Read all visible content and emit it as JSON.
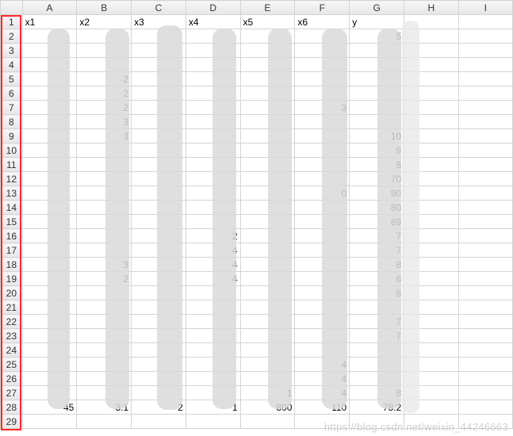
{
  "columns": [
    "A",
    "B",
    "C",
    "D",
    "E",
    "F",
    "G",
    "H",
    "I"
  ],
  "rowCount": 29,
  "headerRow": {
    "A": "x1",
    "B": "x2",
    "C": "x3",
    "D": "x4",
    "E": "x5",
    "F": "x6",
    "G": "y"
  },
  "cells": {
    "r2": {
      "G": "5"
    },
    "r5": {
      "B": "2"
    },
    "r6": {
      "B": "2"
    },
    "r7": {
      "B": "2",
      "F": "3"
    },
    "r8": {
      "B": "3"
    },
    "r9": {
      "B": "3",
      "G": "10"
    },
    "r10": {
      "G": "9"
    },
    "r11": {
      "G": "8"
    },
    "r12": {
      "G": "70"
    },
    "r13": {
      "F": "0",
      "G": "90"
    },
    "r14": {
      "G": "80"
    },
    "r15": {
      "G": "89"
    },
    "r16": {
      "D": "2",
      "G": "7"
    },
    "r17": {
      "D": "4",
      "G": "7"
    },
    "r18": {
      "B": "3",
      "D": "4",
      "G": "8"
    },
    "r19": {
      "B": "2",
      "D": "4",
      "G": "6"
    },
    "r20": {
      "G": "8"
    },
    "r22": {
      "G": "7"
    },
    "r23": {
      "G": "7"
    },
    "r25": {
      "F": "4"
    },
    "r26": {
      "F": "4"
    },
    "r27": {
      "E": "1",
      "F": "4",
      "G": "8"
    },
    "r28": {
      "A": "45",
      "B": "3.1",
      "C": "2",
      "D": "1",
      "E": "800",
      "F": "110",
      "G": "78.2"
    }
  },
  "watermark": "https://blog.csdn.net/weixin_44246663"
}
